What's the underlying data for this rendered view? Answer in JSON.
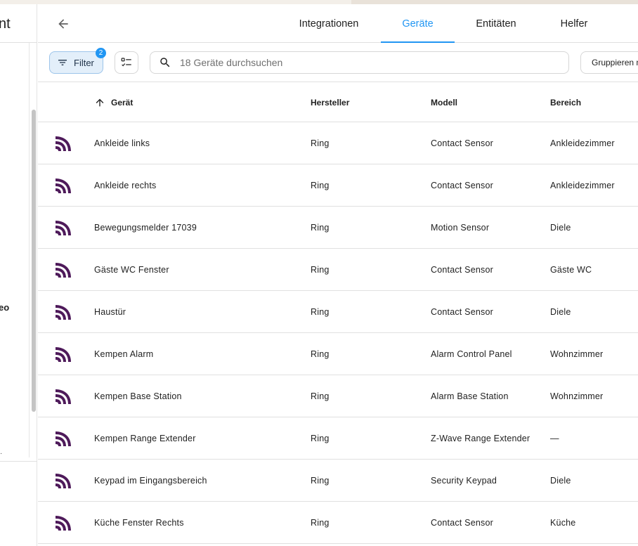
{
  "sidebar": {
    "title_fragment": "nt",
    "text_fragment": "eo",
    "dot_fragment": "·"
  },
  "header": {
    "tabs": [
      {
        "label": "Integrationen",
        "active": false
      },
      {
        "label": "Geräte",
        "active": true
      },
      {
        "label": "Entitäten",
        "active": false
      },
      {
        "label": "Helfer",
        "active": false
      }
    ]
  },
  "toolbar": {
    "filter_label": "Filter",
    "filter_count": "2",
    "search_placeholder": "18 Geräte durchsuchen",
    "search_value": "",
    "group_label": "Gruppieren nach"
  },
  "table": {
    "columns": {
      "device": "Gerät",
      "manufacturer": "Hersteller",
      "model": "Modell",
      "area": "Bereich"
    },
    "sort": {
      "column": "device",
      "direction": "ascending"
    },
    "rows": [
      {
        "name": "Ankleide links",
        "manufacturer": "Ring",
        "model": "Contact Sensor",
        "area": "Ankleidezimmer"
      },
      {
        "name": "Ankleide rechts",
        "manufacturer": "Ring",
        "model": "Contact Sensor",
        "area": "Ankleidezimmer"
      },
      {
        "name": "Bewegungsmelder 17039",
        "manufacturer": "Ring",
        "model": "Motion Sensor",
        "area": "Diele"
      },
      {
        "name": "Gäste WC Fenster",
        "manufacturer": "Ring",
        "model": "Contact Sensor",
        "area": "Gäste WC"
      },
      {
        "name": "Haustür",
        "manufacturer": "Ring",
        "model": "Contact Sensor",
        "area": "Diele"
      },
      {
        "name": "Kempen Alarm",
        "manufacturer": "Ring",
        "model": "Alarm Control Panel",
        "area": "Wohnzimmer"
      },
      {
        "name": "Kempen Base Station",
        "manufacturer": "Ring",
        "model": "Alarm Base Station",
        "area": "Wohnzimmer"
      },
      {
        "name": "Kempen Range Extender",
        "manufacturer": "Ring",
        "model": "Z-Wave Range Extender",
        "area": "—"
      },
      {
        "name": "Keypad im Eingangsbereich",
        "manufacturer": "Ring",
        "model": "Security Keypad",
        "area": "Diele"
      },
      {
        "name": "Küche Fenster Rechts",
        "manufacturer": "Ring",
        "model": "Contact Sensor",
        "area": "Küche"
      }
    ]
  },
  "icons": {
    "row_icon": "ring-integration-icon",
    "row_icon_color": "#4e1a5a",
    "accent_color": "#2196f3"
  }
}
